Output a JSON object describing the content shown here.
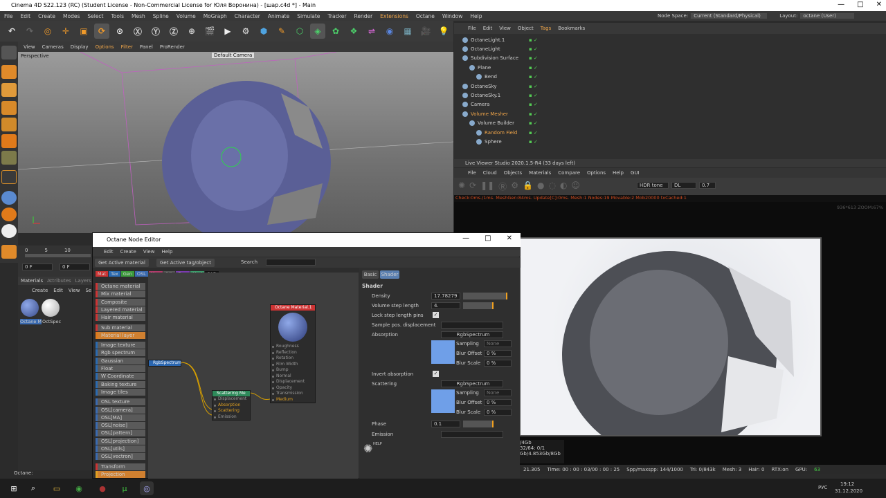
{
  "window": {
    "title": "Cinema 4D S22.123 (RC) (Student License - Non-Commercial License for Юля Воронина) - [шар.c4d *] - Main",
    "buttons": [
      "—",
      "□",
      "✕"
    ]
  },
  "menu": [
    "File",
    "Edit",
    "Create",
    "Modes",
    "Select",
    "Tools",
    "Mesh",
    "Spline",
    "Volume",
    "MoGraph",
    "Character",
    "Animate",
    "Simulate",
    "Tracker",
    "Render",
    "Extensions",
    "Octane",
    "Window",
    "Help"
  ],
  "nodespace": {
    "label": "Node Space:",
    "value": "Current (Standard/Physical)"
  },
  "layout": {
    "label": "Layout:",
    "value": "octane (User)"
  },
  "viewport": {
    "menu": [
      "View",
      "Cameras",
      "Display",
      "Options",
      "Filter",
      "Panel",
      "ProRender"
    ],
    "label": "Perspective",
    "camera": "Default Camera"
  },
  "objmgr": {
    "menu": [
      "File",
      "Edit",
      "View",
      "Object",
      "Tags",
      "Bookmarks"
    ],
    "objects": [
      {
        "name": "OctaneLight.1",
        "indent": 0
      },
      {
        "name": "OctaneLight",
        "indent": 0
      },
      {
        "name": "Subdivision Surface",
        "indent": 0
      },
      {
        "name": "Plane",
        "indent": 1
      },
      {
        "name": "Bend",
        "indent": 2
      },
      {
        "name": "OctaneSky",
        "indent": 0
      },
      {
        "name": "OctaneSky.1",
        "indent": 0
      },
      {
        "name": "Camera",
        "indent": 0
      },
      {
        "name": "Volume Mesher",
        "indent": 0,
        "orange": true
      },
      {
        "name": "Volume Builder",
        "indent": 1
      },
      {
        "name": "Random Field",
        "indent": 2,
        "orange": true
      },
      {
        "name": "Sphere",
        "indent": 2
      }
    ]
  },
  "liveviewer": {
    "title": "Live Viewer Studio 2020.1.5-R4 (33 days left)",
    "menu": [
      "File",
      "Cloud",
      "Objects",
      "Materials",
      "Compare",
      "Options",
      "Help",
      "GUI"
    ],
    "tonemode": "HDR tone",
    "mode": "DL",
    "value": "0.7",
    "status": "Check:0ms./1ms. MeshGen:84ms. Update[C]:0ms. Mesh:1 Nodes:19 Movable:2 Mob20000 txCached:1",
    "zoom": "936*613 ZOOM:67%",
    "stats": [
      "/4Gb",
      "32/64: 0/1",
      "Gb/4.853Gb/8Gb"
    ]
  },
  "statusbar": {
    "time": "Time: 00 : 00 : 03/00 : 00 : 25",
    "spp": "Spp/maxspp: 144/1000",
    "tri": "Tri: 0/843k",
    "mesh": "Mesh: 3",
    "hair": "Hair: 0",
    "rtx": "RTX:on",
    "gpu": "GPU:",
    "gpuval": "63",
    "ms": "21.305"
  },
  "nodeeditor": {
    "title": "Octane Node Editor",
    "menu": [
      "Edit",
      "Create",
      "View",
      "Help"
    ],
    "btn_active_mat": "Get Active material",
    "btn_active_tag": "Get Active tag/object",
    "search": "Search",
    "tabs": [
      "Mat",
      "Tex",
      "Gen",
      "OSL",
      "Map",
      "Oth",
      "Ems",
      "Med",
      "CAD"
    ],
    "palette": [
      "Octane material",
      "Mix material",
      "Composite material",
      "Layered material",
      "Hair material",
      "Sub material",
      "Material layer",
      "Image texture",
      "Rgb spectrum",
      "Gaussian spectrum",
      "Float",
      "W Coordinate",
      "Baking texture",
      "Image tiles",
      "OSL texture",
      "OSL[camera]",
      "OSL[MA]",
      "OSL[noise]",
      "OSL[pattern]",
      "OSL[projection]",
      "OSL[utils]",
      "OSL[vectron]",
      "Transform",
      "Projection"
    ],
    "node_rgb": "RgbSpectrum",
    "node_scatter": {
      "title": "Scattering Me",
      "pins": [
        "Displacement",
        "Absorption",
        "Scattering",
        "Emission"
      ]
    },
    "node_mat": {
      "title": "Octane Material.1",
      "pins": [
        "Roughness",
        "Reflection",
        "Rotation",
        "Film Width",
        "Bump",
        "Normal",
        "Displacement",
        "Opacity",
        "Transmission",
        "Medium"
      ]
    },
    "prop_tabs": [
      "Basic",
      "Shader"
    ],
    "section": "Shader",
    "props": {
      "density_label": "Density",
      "density": "17.78279",
      "volstep_label": "Volume step length",
      "volstep": "4.",
      "lock_label": "Lock step length pins",
      "sample_label": "Sample pos. displacement",
      "absorption_label": "Absorption",
      "absorption": "RgbSpectrum",
      "sampling_label": "Sampling",
      "sampling": "None",
      "bluroffset_label": "Blur Offset",
      "bluroffset": "0 %",
      "blurscale_label": "Blur Scale",
      "blurscale": "0 %",
      "invert_label": "Invert absorption",
      "scattering_label": "Scattering",
      "scattering": "RgbSpectrum",
      "phase_label": "Phase",
      "phase": "0.1",
      "emission_label": "Emission",
      "help": "HELP"
    },
    "swatch_color": "#6f9fe8"
  },
  "materials": {
    "tabs": [
      "Materials",
      "Attributes",
      "Layers"
    ],
    "menu": [
      "Create",
      "Edit",
      "View",
      "Se"
    ],
    "items": [
      "Octane M",
      "OctSpec"
    ]
  },
  "timeline": {
    "ticks": [
      "0",
      "5",
      "10"
    ],
    "f1": "0 F",
    "f2": "0 F"
  },
  "octane_label": "Octane:",
  "taskbar": {
    "lang": "РУС",
    "time": "19:12",
    "date": "31.12.2020"
  }
}
